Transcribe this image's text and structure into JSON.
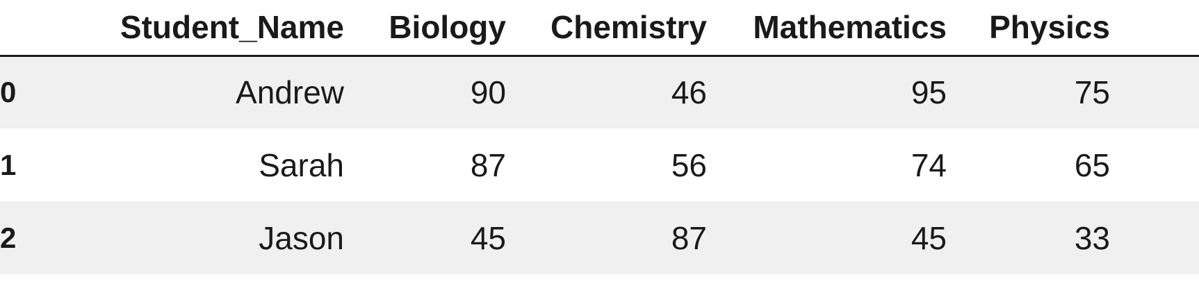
{
  "table": {
    "index_header": "",
    "columns": [
      "Student_Name",
      "Biology",
      "Chemistry",
      "Mathematics",
      "Physics"
    ],
    "rows": [
      {
        "index": "0",
        "cells": [
          "Andrew",
          "90",
          "46",
          "95",
          "75"
        ]
      },
      {
        "index": "1",
        "cells": [
          "Sarah",
          "87",
          "56",
          "74",
          "65"
        ]
      },
      {
        "index": "2",
        "cells": [
          "Jason",
          "45",
          "87",
          "45",
          "33"
        ]
      }
    ]
  },
  "colors": {
    "stripe_background": "#f0f0f0",
    "header_rule": "#1a1a1a",
    "text": "#1a1a1a"
  }
}
